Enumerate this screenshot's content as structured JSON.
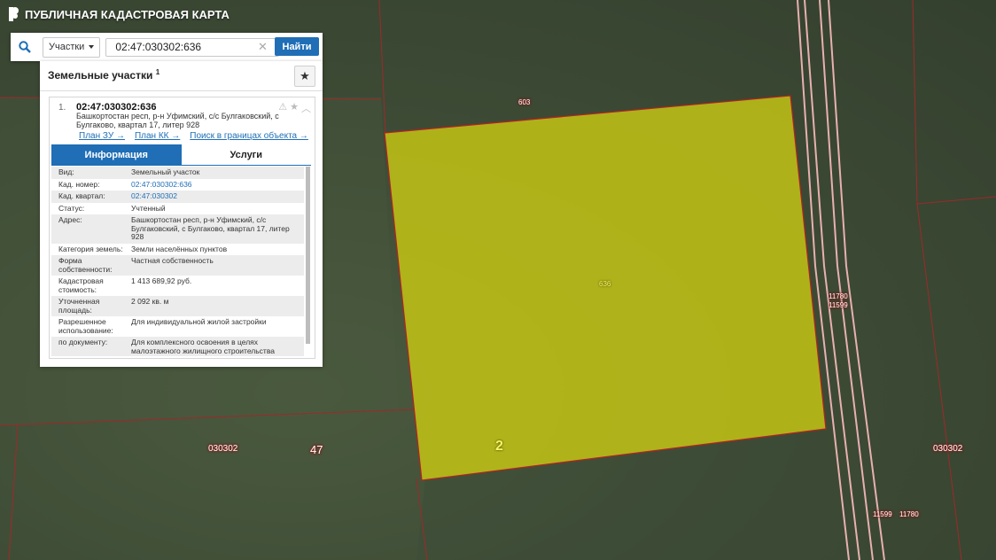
{
  "app": {
    "title": "ПУБЛИЧНАЯ КАДАСТРОВАЯ КАРТА"
  },
  "search": {
    "type_label": "Участки",
    "query": "02:47:030302:636",
    "find_label": "Найти"
  },
  "panel": {
    "title": "Земельные участки",
    "count": "1"
  },
  "result": {
    "index": "1.",
    "number": "02:47:030302:636",
    "address": "Башкортостан респ, р-н Уфимский, с/с Булгаковский, с Булгаково, квартал 17, литер 928",
    "links": [
      "План ЗУ →",
      "План КК →",
      "Поиск в границах объекта →"
    ],
    "tabs": [
      "Информация",
      "Услуги"
    ],
    "info": [
      {
        "k": "Вид:",
        "v": "Земельный участок"
      },
      {
        "k": "Кад. номер:",
        "v": "02:47:030302:636"
      },
      {
        "k": "Кад. квартал:",
        "v": "02:47:030302"
      },
      {
        "k": "Статус:",
        "v": "Учтенный"
      },
      {
        "k": "Адрес:",
        "v": "Башкортостан респ, р-н Уфимский, с/с Булгаковский, с Булгаково, квартал 17, литер 928"
      },
      {
        "k": "Категория земель:",
        "v": "Земли населённых пунктов"
      },
      {
        "k": "Форма собственности:",
        "v": "Частная собственность"
      },
      {
        "k": "Кадастровая стоимость:",
        "v": "1 413 689,92 руб."
      },
      {
        "k": "Уточненная площадь:",
        "v": "2 092 кв. м"
      },
      {
        "k": "Разрешенное использование:",
        "v": "Для индивидуальной жилой застройки"
      },
      {
        "k": "по документу:",
        "v": "Для комплексного освоения в целях малоэтажного жилищного строительства"
      }
    ]
  },
  "map_labels": {
    "parcel_603": "603",
    "parcel_636": "636",
    "parcel_11780_a": "11780",
    "parcel_11599_a": "11599",
    "parcel_11599_b": "11599",
    "parcel_11780_b": "11780",
    "quarter_left": "030302",
    "quarter_right": "030302",
    "num_47": "47",
    "num_2": "2"
  },
  "colors": {
    "accent": "#1f6eb6",
    "parcel_fill": "#c8c814",
    "boundary": "#b52222"
  }
}
